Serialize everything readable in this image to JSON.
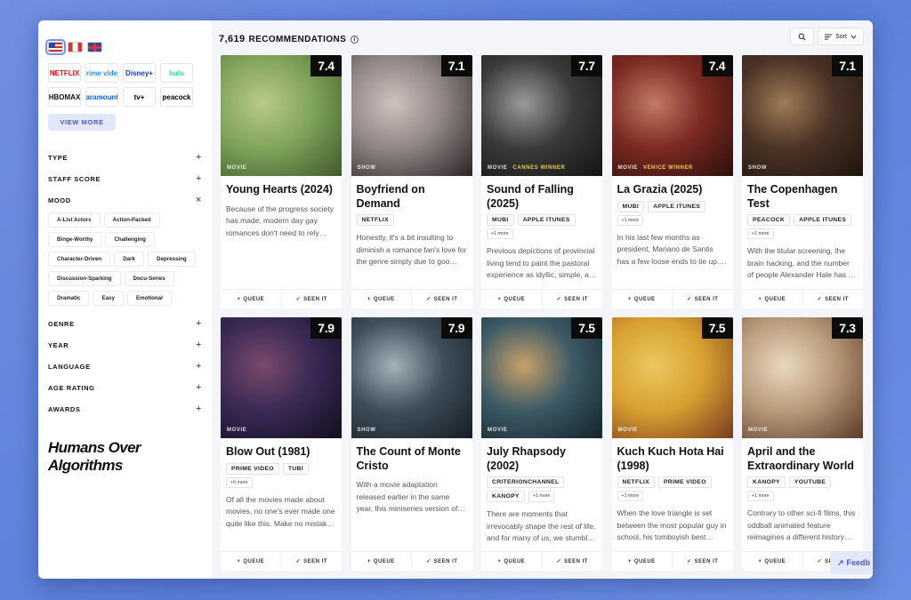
{
  "sidebar": {
    "flags": [
      {
        "name": "us-flag-icon",
        "selected": true
      },
      {
        "name": "canada-flag-icon",
        "selected": false
      },
      {
        "name": "uk-flag-icon",
        "selected": false
      }
    ],
    "services": [
      {
        "label": "NETFLIX",
        "color": "#e50914"
      },
      {
        "label": "prime video",
        "color": "#1a98ff"
      },
      {
        "label": "Disney+",
        "color": "#113ccf"
      },
      {
        "label": "hulu",
        "color": "#1ce783"
      },
      {
        "label": "HBOMAX",
        "color": "#111111"
      },
      {
        "label": "Paramount+",
        "color": "#0064ff"
      },
      {
        "label": "tv+",
        "color": "#000000"
      },
      {
        "label": "peacock",
        "color": "#000000"
      }
    ],
    "view_more": "VIEW MORE",
    "filters_top": [
      {
        "label": "TYPE",
        "toggle": "+"
      },
      {
        "label": "STAFF SCORE",
        "toggle": "+"
      },
      {
        "label": "MOOD",
        "toggle": "×"
      }
    ],
    "moods": [
      "A-List Actors",
      "Action-Packed",
      "Binge-Worthy",
      "Challenging",
      "Character-Driven",
      "Dark",
      "Depressing",
      "Discussion-Sparking",
      "Docu-Series",
      "Dramatic",
      "Easy",
      "Emotional"
    ],
    "filters_bottom": [
      {
        "label": "GENRE",
        "toggle": "+"
      },
      {
        "label": "YEAR",
        "toggle": "+"
      },
      {
        "label": "LANGUAGE",
        "toggle": "+"
      },
      {
        "label": "AGE RATING",
        "toggle": "+"
      },
      {
        "label": "AWARDS",
        "toggle": "+"
      }
    ],
    "slogan": [
      "Humans Over",
      "Algorithms"
    ]
  },
  "header": {
    "count": "7,619",
    "label": "RECOMMENDATIONS",
    "info": "i",
    "sort_label": "Sort"
  },
  "cards": [
    {
      "title": "Young Hearts (2024)",
      "score": "7.4",
      "type": "MOVIE",
      "award": "",
      "platforms": [],
      "more": "",
      "description": "Because of the progress society has made, modern day gay romances don't need to rely on…",
      "palette": [
        "#7fa35a",
        "#b9c98a",
        "#3f5a2a"
      ]
    },
    {
      "title": "Boyfriend on Demand",
      "score": "7.1",
      "type": "SHOW",
      "award": "",
      "platforms": [
        "NETFLIX"
      ],
      "more": "",
      "description": "Honestly, it's a bit insulting to diminish a romance fan's love for the genre simply due to goo…",
      "palette": [
        "#8f8585",
        "#cfc2bd",
        "#2a2424"
      ]
    },
    {
      "title": "Sound of Falling (2025)",
      "score": "7.7",
      "type": "MOVIE",
      "award": "CANNES WINNER",
      "platforms": [
        "MUBI",
        "APPLE ITUNES"
      ],
      "more": "+1 more",
      "description": "Previous depictions of provincial living tend to paint the pastoral experience as idyllic, simple, a…",
      "palette": [
        "#3a3a3a",
        "#9a9a9a",
        "#141414"
      ]
    },
    {
      "title": "La Grazia (2025)",
      "score": "7.4",
      "type": "MOVIE",
      "award": "VENICE WINNER",
      "platforms": [
        "MUBI",
        "APPLE ITUNES"
      ],
      "more": "+1 more",
      "description": "In his last few months as president, Mariano de Santis has a few loose ends to tie up. This…",
      "palette": [
        "#7a2a22",
        "#c47a63",
        "#2e0f0c"
      ]
    },
    {
      "title": "The Copenhagen Test",
      "score": "7.1",
      "type": "SHOW",
      "award": "",
      "platforms": [
        "PEACOCK",
        "APPLE ITUNES"
      ],
      "more": "+1 more",
      "description": "With the titular screening, the brain hacking, and the number of people Alexander Hale has to li…",
      "palette": [
        "#4a3326",
        "#a07a55",
        "#1e140e"
      ]
    },
    {
      "title": "Blow Out (1981)",
      "score": "7.9",
      "type": "MOVIE",
      "award": "",
      "platforms": [
        "PRIME VIDEO",
        "TUBI"
      ],
      "more": "+6 more",
      "description": "Of all the movies made about movies, no one's ever made one quite like this. Make no mistak…",
      "palette": [
        "#3a2a55",
        "#7a4a6a",
        "#120d1e"
      ]
    },
    {
      "title": "The Count of Monte Cristo",
      "score": "7.9",
      "type": "SHOW",
      "award": "",
      "platforms": [],
      "more": "",
      "description": "With a movie adaptation released earlier in the same year, this miniseries version of the…",
      "palette": [
        "#3e4e5a",
        "#a3b1b8",
        "#161e24"
      ]
    },
    {
      "title": "July Rhapsody (2002)",
      "score": "7.5",
      "type": "MOVIE",
      "award": "",
      "platforms": [
        "CRITERIONCHANNEL",
        "KANOPY"
      ],
      "more": "+1 more",
      "description": "There are moments that irrevocably shape the rest of life, and for many of us, we stumbl…",
      "palette": [
        "#3c5a66",
        "#c9a06a",
        "#14232a"
      ]
    },
    {
      "title": "Kuch Kuch Hota Hai (1998)",
      "score": "7.5",
      "type": "MOVIE",
      "award": "",
      "platforms": [
        "NETFLIX",
        "PRIME VIDEO"
      ],
      "more": "+1 more",
      "description": "When the love triangle is set between the most popular guy in school, his tomboyish best…",
      "palette": [
        "#d8a030",
        "#e8c860",
        "#7a3a20"
      ]
    },
    {
      "title": "April and the Extraordinary World",
      "score": "7.3",
      "type": "MOVIE",
      "award": "",
      "platforms": [
        "KANOPY",
        "YOUTUBE"
      ],
      "more": "+1 more",
      "description": "Contrary to other sci-fi films, this oddball animated feature reimagines a different history…",
      "palette": [
        "#b89a7a",
        "#e8d8c0",
        "#5a3a2a"
      ]
    }
  ],
  "actions": {
    "queue": "QUEUE",
    "seen": "SEEN IT"
  },
  "feedback": "Feedb"
}
